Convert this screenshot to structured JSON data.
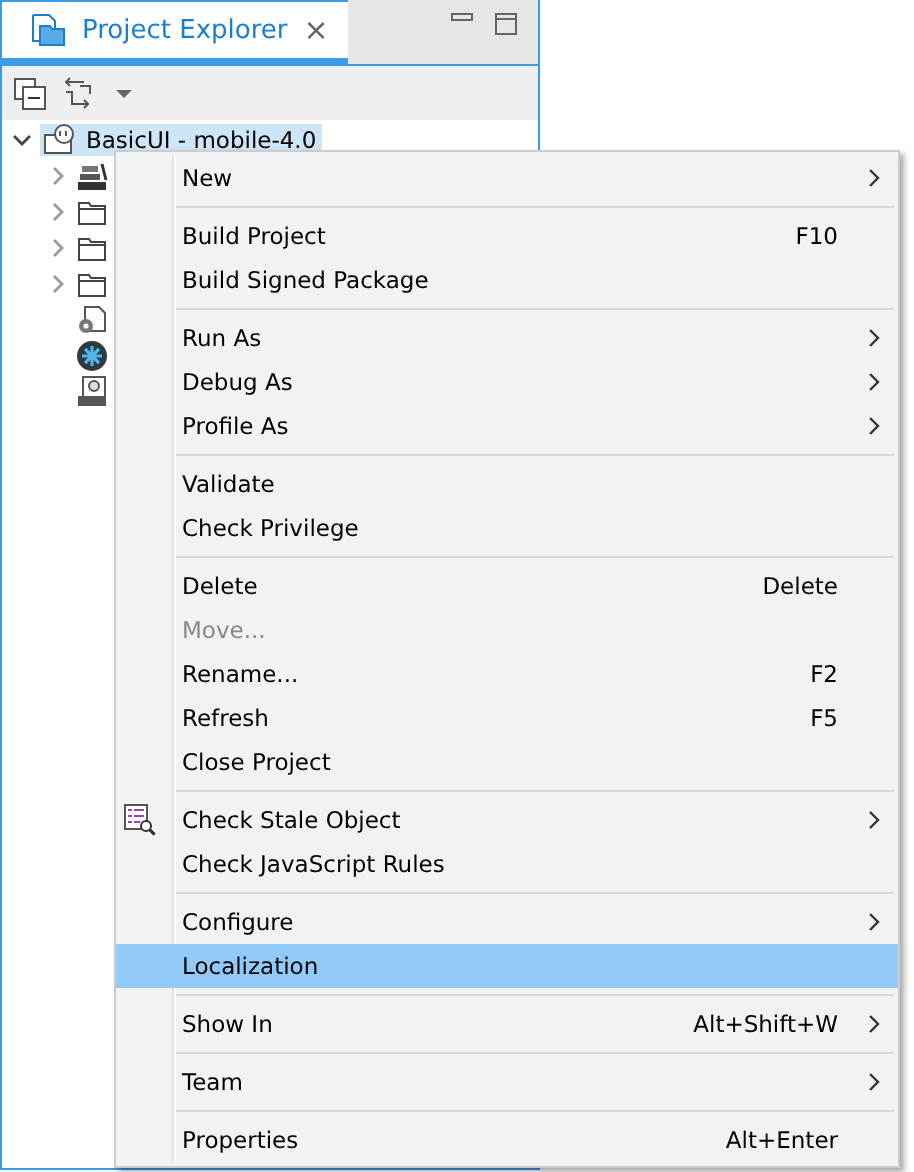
{
  "view": {
    "tab": {
      "title": "Project Explorer",
      "selected": true,
      "close": "×"
    }
  },
  "tree": [
    {
      "label": "BasicUI - mobile-4.0",
      "expanded": true,
      "selected": true,
      "children": [
        {
          "kind": "library",
          "expanded": false
        },
        {
          "kind": "folder",
          "expanded": false
        },
        {
          "kind": "folder",
          "expanded": false
        },
        {
          "kind": "folder",
          "expanded": false
        },
        {
          "kind": "config-file"
        },
        {
          "kind": "app"
        },
        {
          "kind": "html-file"
        }
      ]
    }
  ],
  "context_menu": {
    "groups": [
      [
        {
          "label": "New",
          "submenu": true,
          "disabled": false,
          "selected": false
        }
      ],
      [
        {
          "label": "Build Project",
          "shortcut": "F10",
          "submenu": false,
          "disabled": false,
          "selected": false
        },
        {
          "label": "Build Signed Package",
          "submenu": false,
          "disabled": false,
          "selected": false
        }
      ],
      [
        {
          "label": "Run As",
          "submenu": true,
          "disabled": false,
          "selected": false
        },
        {
          "label": "Debug As",
          "submenu": true,
          "disabled": false,
          "selected": false
        },
        {
          "label": "Profile As",
          "submenu": true,
          "disabled": false,
          "selected": false
        }
      ],
      [
        {
          "label": "Validate",
          "submenu": false,
          "disabled": false,
          "selected": false
        },
        {
          "label": "Check Privilege",
          "submenu": false,
          "disabled": false,
          "selected": false
        }
      ],
      [
        {
          "label": "Delete",
          "shortcut": "Delete",
          "submenu": false,
          "disabled": false,
          "selected": false
        },
        {
          "label": "Move...",
          "submenu": false,
          "disabled": true,
          "selected": false
        },
        {
          "label": "Rename...",
          "shortcut": "F2",
          "submenu": false,
          "disabled": false,
          "selected": false
        },
        {
          "label": "Refresh",
          "shortcut": "F5",
          "submenu": false,
          "disabled": false,
          "selected": false
        },
        {
          "label": "Close Project",
          "submenu": false,
          "disabled": false,
          "selected": false
        }
      ],
      [
        {
          "label": "Check Stale Object",
          "kind": "with-icon",
          "submenu": true,
          "disabled": false,
          "selected": false
        },
        {
          "label": "Check JavaScript Rules",
          "submenu": false,
          "disabled": false,
          "selected": false
        }
      ],
      [
        {
          "label": "Configure",
          "submenu": true,
          "disabled": false,
          "selected": false
        },
        {
          "label": "Localization",
          "submenu": false,
          "disabled": false,
          "selected": true
        }
      ],
      [
        {
          "label": "Show In",
          "shortcut": "Alt+Shift+W",
          "submenu": true,
          "disabled": false,
          "selected": false
        }
      ],
      [
        {
          "label": "Team",
          "submenu": true,
          "disabled": false,
          "selected": false
        }
      ],
      [
        {
          "label": "Properties",
          "shortcut": "Alt+Enter",
          "submenu": false,
          "disabled": false,
          "selected": false
        }
      ]
    ]
  }
}
